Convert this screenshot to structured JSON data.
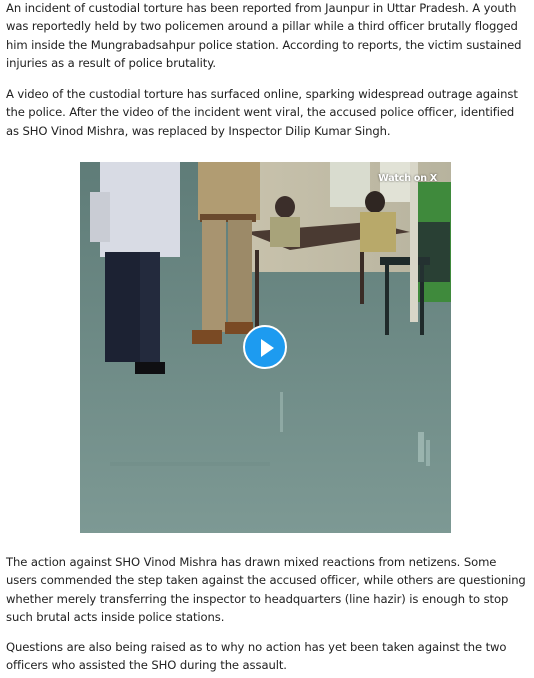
{
  "article": {
    "paragraphs": [
      "An incident of custodial torture has been reported from Jaunpur in Uttar Pradesh. A youth was reportedly held by two policemen around a pillar while a third officer brutally flogged him inside the Mungrabadsahpur police station. According to reports, the victim sustained injuries as a result of police brutality.",
      "A video of the custodial torture has surfaced online, sparking widespread outrage against the police. After the video of the incident went viral, the accused police officer, identified as SHO Vinod Mishra, was replaced by Inspector Dilip Kumar Singh.",
      "The action against SHO Vinod Mishra has drawn mixed reactions from netizens. Some users commended the step taken against the accused officer, while others are questioning whether merely transferring the inspector to headquarters (line hazir) is enough to stop such brutal acts inside police stations.",
      "Questions are also being raised as to why no action has yet been taken against the two officers who assisted the SHO during the assault."
    ]
  },
  "video_embed": {
    "badge_label": "Watch on X",
    "play_icon": "play-icon",
    "accent_color": "#1d9bf0"
  }
}
